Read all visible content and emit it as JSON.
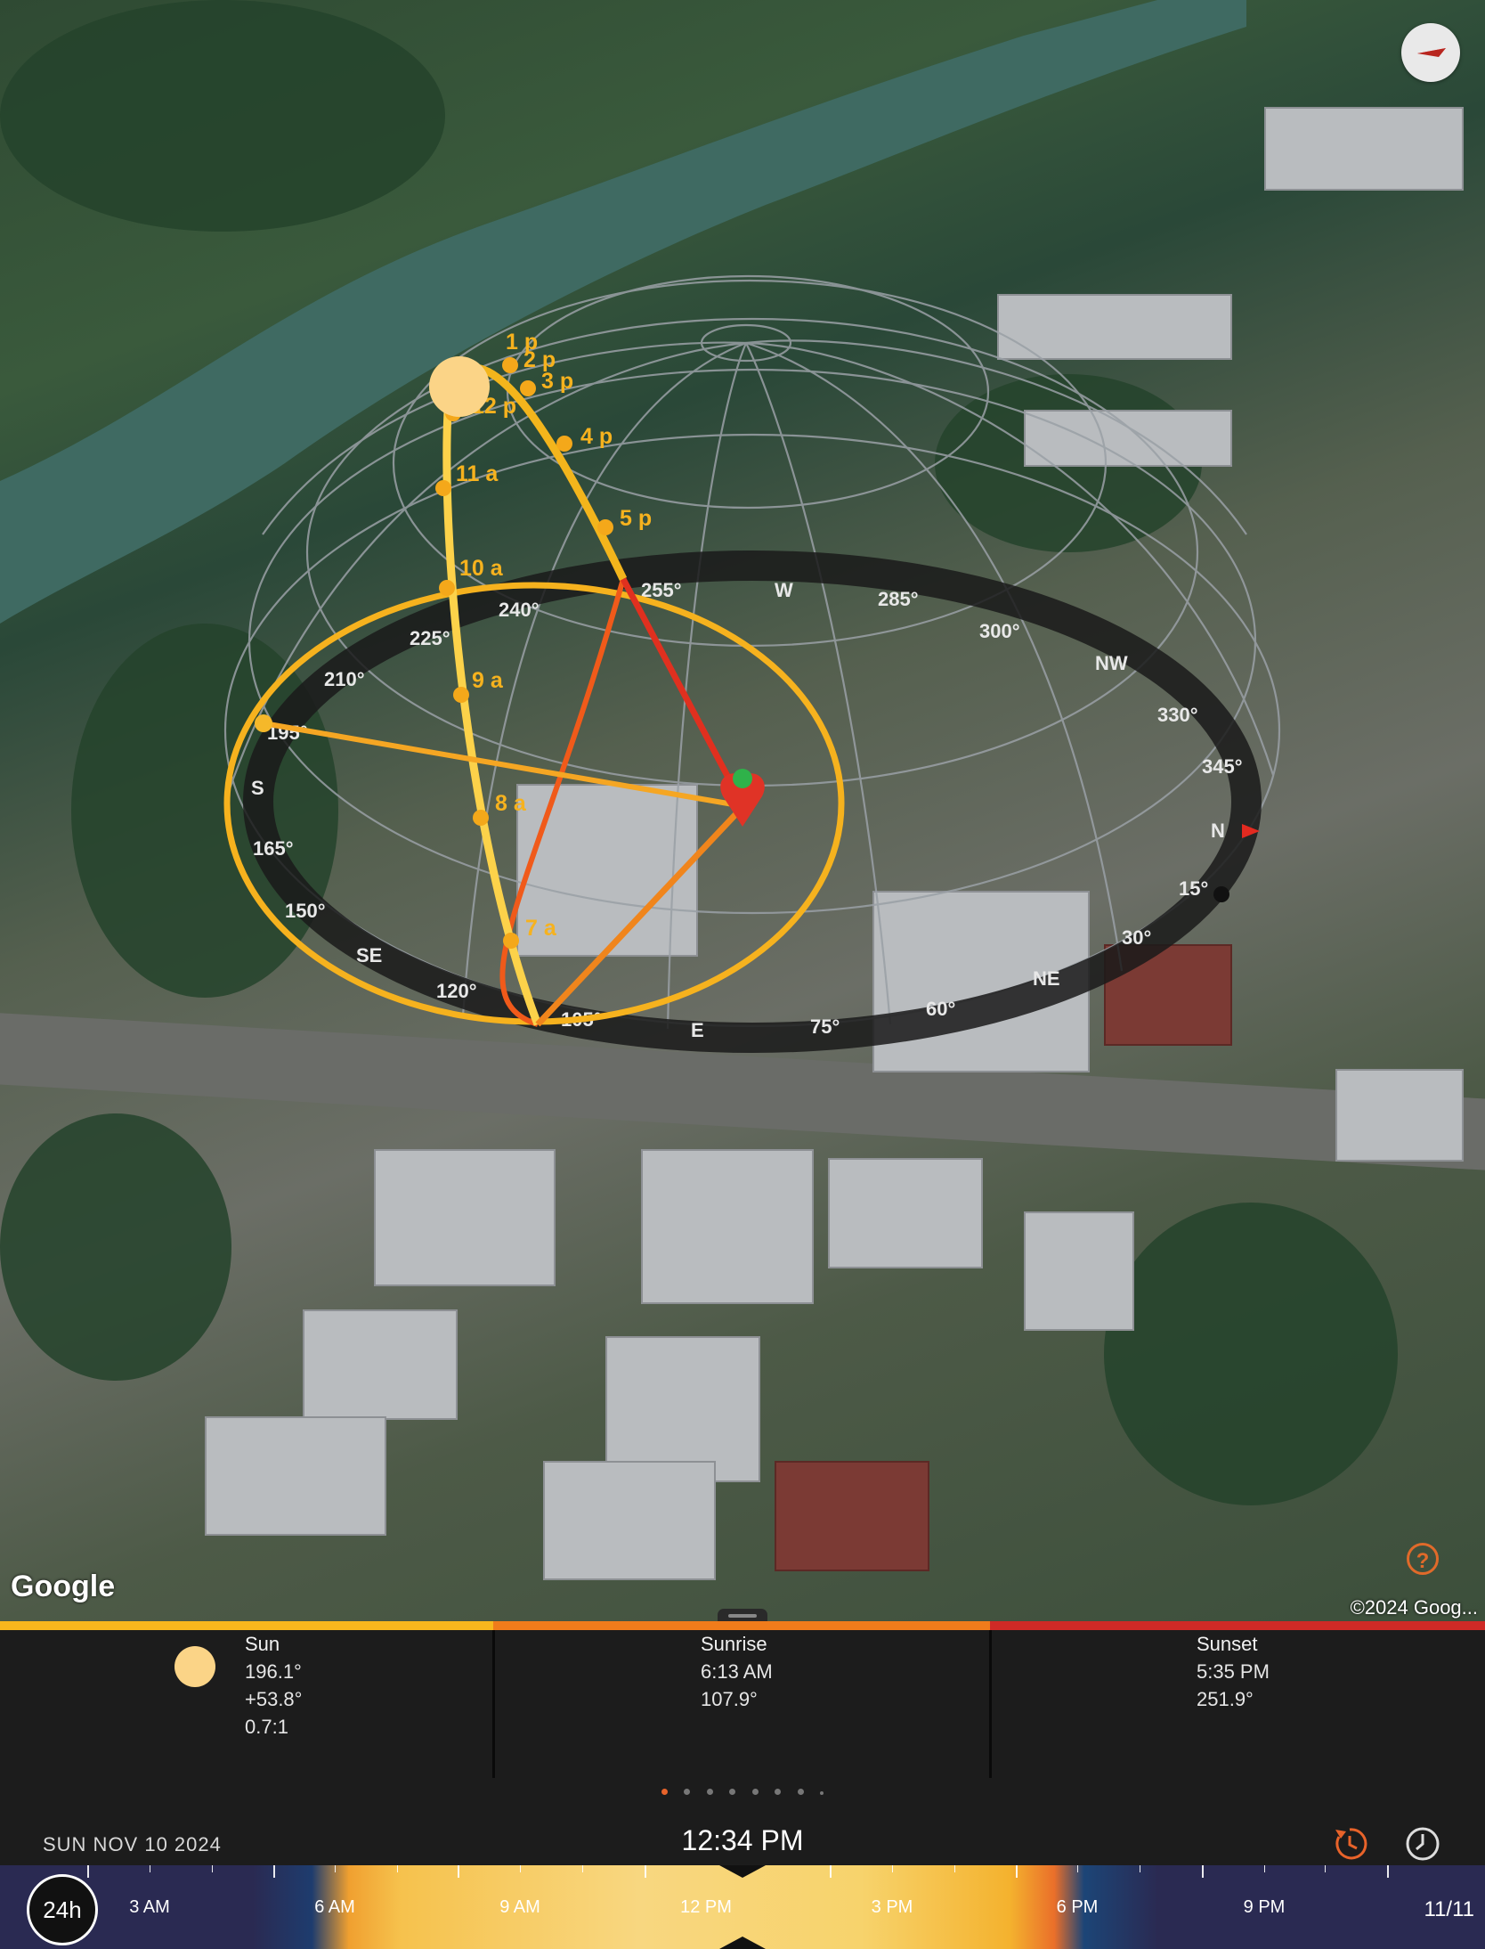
{
  "map": {
    "attribution_logo": "Google",
    "copyright": "©2024 Goog...",
    "hour_labels": [
      "1 p",
      "2 p",
      "3 p",
      "12 p",
      "4 p",
      "11 a",
      "5 p",
      "10 a",
      "9 a",
      "8 a",
      "7 a"
    ],
    "compass_labels": [
      "255°",
      "W",
      "285°",
      "300°",
      "NW",
      "330°",
      "345°",
      "N",
      "15°",
      "30°",
      "NE",
      "60°",
      "75°",
      "E",
      "105°",
      "120°",
      "SE",
      "150°",
      "165°",
      "S",
      "195°",
      "210°",
      "225°",
      "240°"
    ]
  },
  "info": {
    "sun": {
      "title": "Sun",
      "azimuth": "196.1°",
      "elevation": "+53.8°",
      "shadow_ratio": "0.7:1"
    },
    "sunrise": {
      "title": "Sunrise",
      "time": "6:13 AM",
      "azimuth": "107.9°"
    },
    "sunset": {
      "title": "Sunset",
      "time": "5:35 PM",
      "azimuth": "251.9°"
    },
    "colors": {
      "sun_bar": "#f8b71d",
      "sunrise_bar": "#f07c1b",
      "sunset_bar": "#cf2a26"
    }
  },
  "pager": {
    "pages": 8,
    "active_index": 0
  },
  "timebar": {
    "date": "SUN NOV 10 2024",
    "time": "12:34 PM",
    "mode_badge": "24h",
    "end_date": "11/11",
    "labels": [
      "3 AM",
      "6 AM",
      "9 AM",
      "12 PM",
      "3 PM",
      "6 PM",
      "9 PM"
    ]
  },
  "icons": {
    "compass": "compass-arrow-icon",
    "help": "help-icon",
    "reset_time": "time-reset-icon",
    "clock": "clock-icon"
  }
}
